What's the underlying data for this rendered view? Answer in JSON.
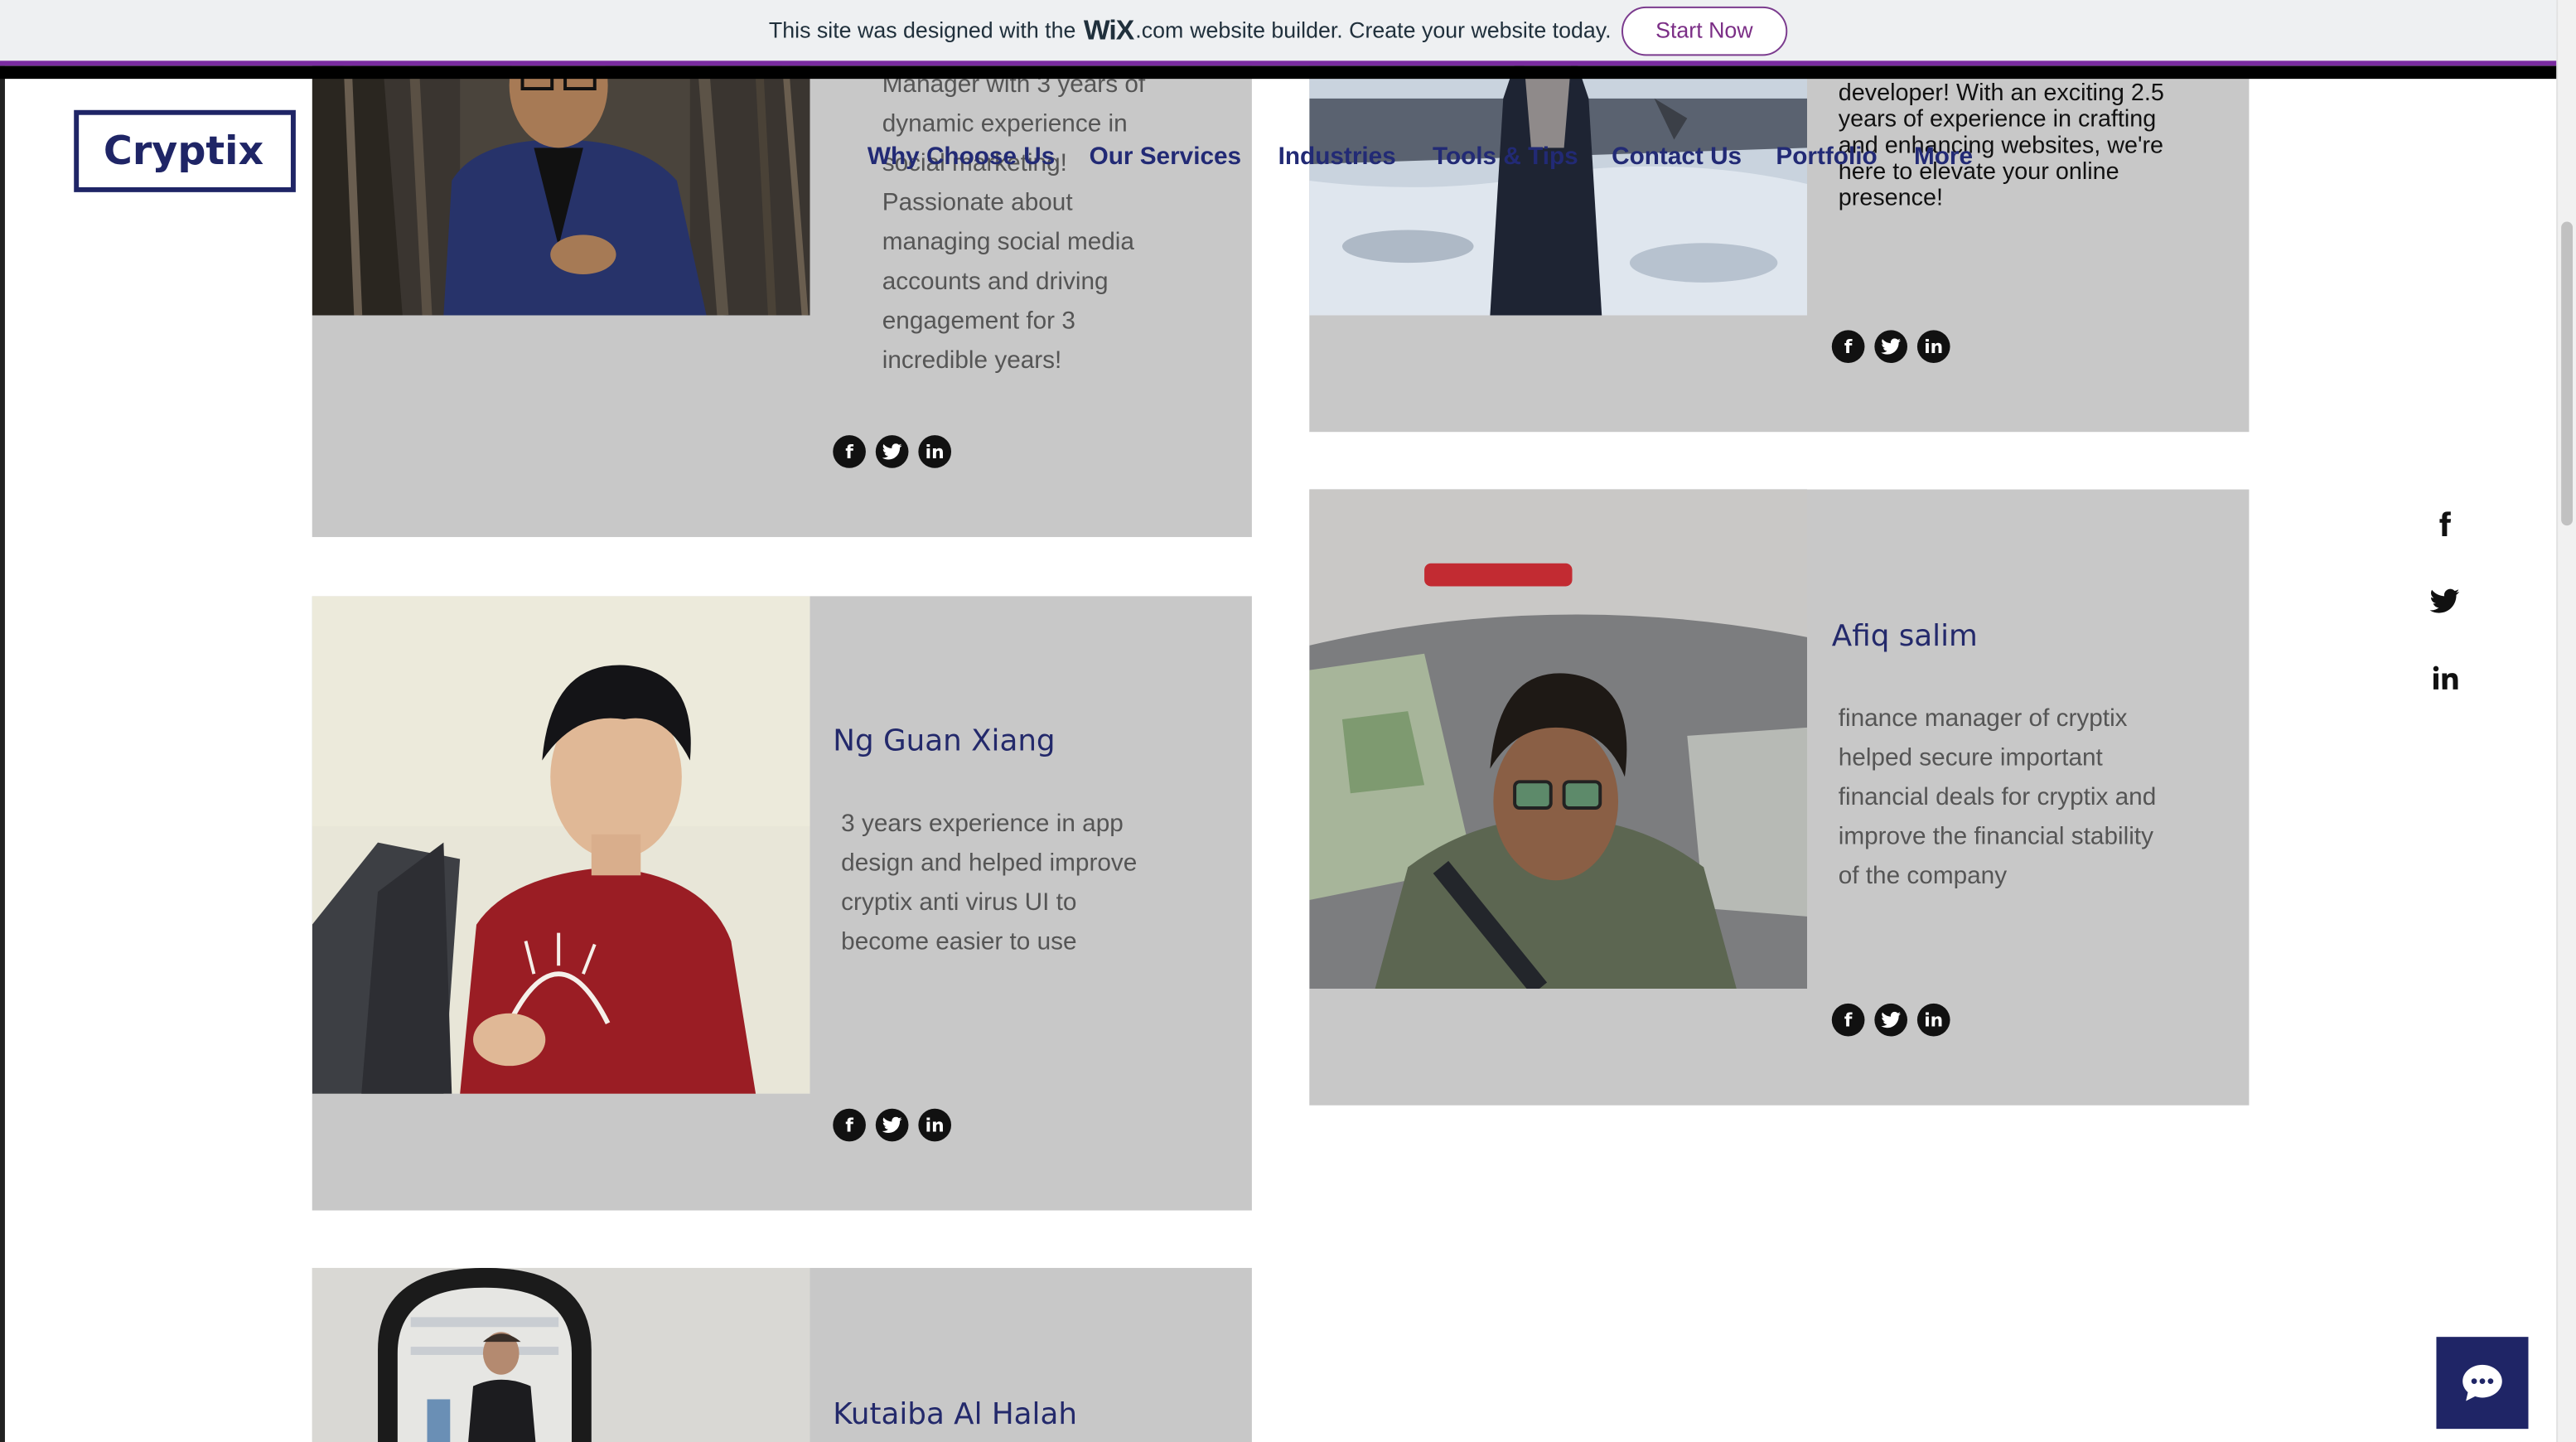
{
  "banner": {
    "text_before": "This site was designed with the",
    "wix_logo": "WiX",
    "wix_domain": ".com",
    "text_after": "website builder. Create your website today.",
    "button_label": "Start Now"
  },
  "header": {
    "logo": "Cryptix",
    "nav": [
      "Why Choose Us",
      "Our Services",
      "Industries",
      "Tools & Tips",
      "Contact Us",
      "Portfolio",
      "More"
    ]
  },
  "cards": {
    "top_left": {
      "bio": "Manager with 3 years of dynamic experience in social marketing! Passionate about managing social media accounts and driving engagement for 3 incredible years!"
    },
    "top_right": {
      "bio": "developer! With an exciting 2.5 years of experience in crafting and enhancing websites, we're here to elevate your online presence!"
    },
    "ng": {
      "name": "Ng Guan Xiang",
      "bio": "3 years experience in app design and helped improve cryptix anti virus UI to become easier to use"
    },
    "afiq": {
      "name": "Afiq salim",
      "bio": "finance manager of cryptix helped secure important financial deals for cryptix and improve the financial stability of the company"
    },
    "kutaiba": {
      "name": "Kutaiba Al Halah"
    }
  },
  "social_icons": [
    "facebook-icon",
    "twitter-icon",
    "linkedin-icon"
  ],
  "colors": {
    "brand_navy": "#1f2566",
    "card_gray": "#c8c8c8",
    "banner_purple": "#7a2ba0"
  }
}
